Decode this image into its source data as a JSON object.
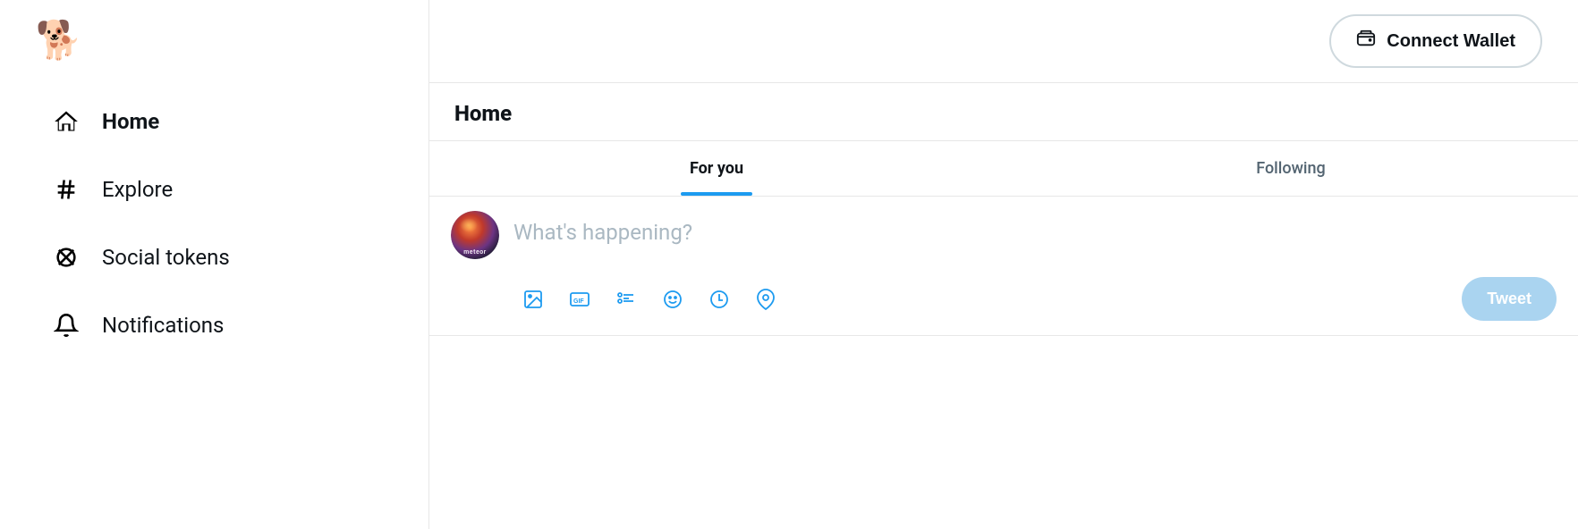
{
  "sidebar": {
    "logo_emoji": "🐕",
    "nav_items": [
      {
        "id": "home",
        "label": "Home",
        "icon": "home",
        "active": true
      },
      {
        "id": "explore",
        "label": "Explore",
        "icon": "hash",
        "active": false
      },
      {
        "id": "social-tokens",
        "label": "Social tokens",
        "icon": "cross",
        "active": false
      },
      {
        "id": "notifications",
        "label": "Notifications",
        "icon": "bell",
        "active": false
      }
    ]
  },
  "header": {
    "connect_wallet_label": "Connect Wallet"
  },
  "main": {
    "page_title": "Home",
    "tabs": [
      {
        "id": "for-you",
        "label": "For you",
        "active": true
      },
      {
        "id": "following",
        "label": "Following",
        "active": false
      }
    ],
    "compose": {
      "placeholder": "What's happening?",
      "tweet_button_label": "Tweet",
      "tools": [
        {
          "id": "image",
          "title": "Image"
        },
        {
          "id": "gif",
          "title": "GIF"
        },
        {
          "id": "poll",
          "title": "Poll"
        },
        {
          "id": "emoji",
          "title": "Emoji"
        },
        {
          "id": "schedule",
          "title": "Schedule"
        },
        {
          "id": "location",
          "title": "Location"
        }
      ]
    }
  },
  "colors": {
    "accent": "#1d9bf0",
    "tweet_btn_disabled": "#aad4f0",
    "border": "#e7e7e7"
  }
}
